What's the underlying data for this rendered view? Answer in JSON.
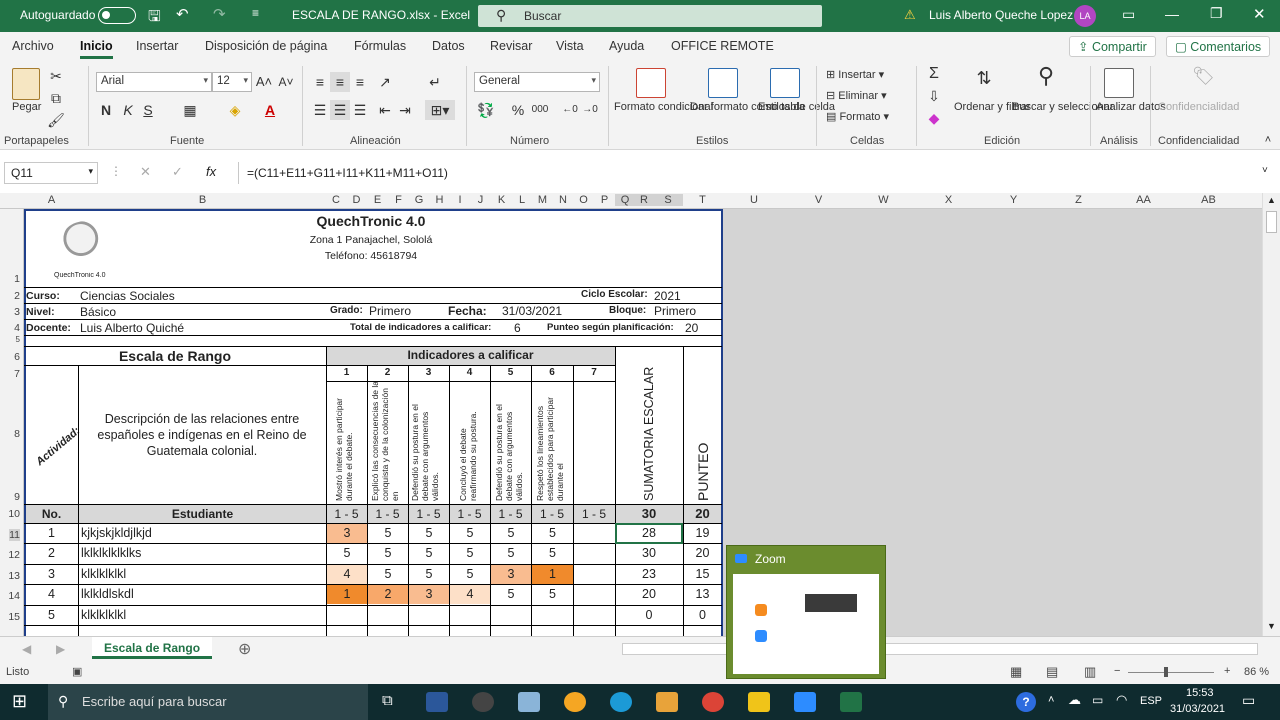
{
  "titlebar": {
    "autosave_label": "Autoguardado",
    "file_title": "ESCALA DE RANGO.xlsx  -  Excel",
    "search_placeholder": "Buscar",
    "user_name": "Luis  Alberto Queche Lopez",
    "user_initials": "LA"
  },
  "menu": {
    "tabs": [
      "Archivo",
      "Inicio",
      "Insertar",
      "Disposición de página",
      "Fórmulas",
      "Datos",
      "Revisar",
      "Vista",
      "Ayuda",
      "OFFICE REMOTE"
    ],
    "share": "Compartir",
    "comments": "Comentarios"
  },
  "ribbon": {
    "paste": "Pegar",
    "font_name": "Arial",
    "font_size": "12",
    "bold": "N",
    "italic": "K",
    "underline": "S",
    "number_format": "General",
    "cond_format": "Formato condicional",
    "table_format": "Dar formato como tabla",
    "cell_styles": "Estilos de celda",
    "insert": "Insertar",
    "delete": "Eliminar",
    "format": "Formato",
    "sort_filter": "Ordenar y filtrar",
    "find_select": "Buscar y seleccionar",
    "analyze": "Analizar datos",
    "confidential": "Confidencialidad",
    "groups": [
      "Portapapeles",
      "Fuente",
      "Alineación",
      "Número",
      "Estilos",
      "Celdas",
      "Edición",
      "Análisis",
      "Confidencialidad"
    ]
  },
  "formula_bar": {
    "name_box": "Q11",
    "formula": "=(C11+E11+G11+I11+K11+M11+O11)"
  },
  "columns": [
    "A",
    "B",
    "C",
    "D",
    "E",
    "F",
    "G",
    "H",
    "I",
    "J",
    "K",
    "L",
    "M",
    "N",
    "O",
    "P",
    "Q",
    "R",
    "S",
    "T",
    "U",
    "V",
    "W",
    "X",
    "Y",
    "Z",
    "AA",
    "AB"
  ],
  "rows": [
    "1",
    "2",
    "3",
    "4",
    "5",
    "6",
    "7",
    "8",
    "9",
    "10",
    "11",
    "12",
    "13",
    "14",
    "15"
  ],
  "sheet": {
    "company": "QuechTronic 4.0",
    "address": "Zona 1 Panajachel, Sololá",
    "phone": "Teléfono: 45618794",
    "logo_caption": "QuechTronic 4.0",
    "curso_label": "Curso:",
    "curso": "Ciencias Sociales",
    "ciclo_label": "Ciclo Escolar:",
    "ciclo": "2021",
    "nivel_label": "Nivel:",
    "nivel": "Básico",
    "grado_label": "Grado:",
    "grado": "Primero",
    "fecha_label": "Fecha:",
    "fecha": "31/03/2021",
    "bloque_label": "Bloque:",
    "bloque": "Primero",
    "docente_label": "Docente:",
    "docente": "Luis Alberto Quiché",
    "total_ind_label": "Total de indicadores a calificar:",
    "total_ind": "6",
    "punteo_plan_label": "Punteo según planificación:",
    "punteo_plan": "20",
    "escala_title": "Escala de Rango",
    "indicadores_title": "Indicadores a calificar",
    "actividad_label": "Actividad:",
    "descripcion": "Descripción de las relaciones entre españoles e indígenas en el Reino de Guatemala colonial.",
    "sumatoria_label": "SUMATORIA ESCALAR",
    "punteo_label": "PUNTEO",
    "indicator_numbers": [
      "1",
      "2",
      "3",
      "4",
      "5",
      "6",
      "7"
    ],
    "indicators": [
      "Mostró interés en participar durante el debate.",
      "Explicó las consecuencias de la conquista y de la colonización en",
      "Defendió su postura en el debate con argumentos válidos.",
      "Concluyó el debate reafirmando su postura.",
      "Defendió su postura en el debate con argumentos válidos.",
      "Respetó los lineamientos establecidos para participar durante el",
      ""
    ],
    "no_label": "No.",
    "estudiante_label": "Estudiante",
    "range_label": "1 - 5",
    "total_escala": "30",
    "total_punteo": "20",
    "students": [
      {
        "no": "1",
        "name": "kjkjskjkldjlkjd",
        "scores": [
          "3",
          "5",
          "5",
          "5",
          "5",
          "5",
          ""
        ],
        "sum": "28",
        "punteo": "19"
      },
      {
        "no": "2",
        "name": "lklklklklklks",
        "scores": [
          "5",
          "5",
          "5",
          "5",
          "5",
          "5",
          ""
        ],
        "sum": "30",
        "punteo": "20"
      },
      {
        "no": "3",
        "name": "klklklklkl",
        "scores": [
          "4",
          "5",
          "5",
          "5",
          "3",
          "1",
          ""
        ],
        "sum": "23",
        "punteo": "15"
      },
      {
        "no": "4",
        "name": "lklkldlskdl",
        "scores": [
          "1",
          "2",
          "3",
          "4",
          "5",
          "5",
          ""
        ],
        "sum": "20",
        "punteo": "13"
      },
      {
        "no": "5",
        "name": "klklklklkl",
        "scores": [
          "",
          "",
          "",
          "",
          "",
          "",
          ""
        ],
        "sum": "0",
        "punteo": "0"
      }
    ]
  },
  "sheet_tab": "Escala de Rango",
  "status": {
    "ready": "Listo",
    "zoom": "86 %"
  },
  "zoom_window": {
    "title": "Zoom"
  },
  "taskbar": {
    "search_placeholder": "Escribe aquí para buscar",
    "lang": "ESP",
    "time": "15:53",
    "date": "31/03/2021"
  },
  "colors": {
    "excel_green": "#217346",
    "score_5": "#ffffff",
    "score_4": "#fde0c8",
    "score_3": "#f9bc90",
    "score_2": "#f8a86a",
    "score_1": "#f08a2c"
  }
}
